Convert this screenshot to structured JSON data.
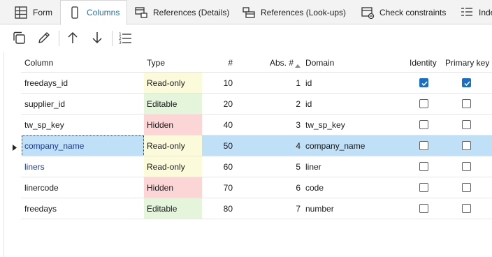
{
  "tabs": [
    {
      "label": "Form",
      "icon": "grid-form-icon",
      "active": false
    },
    {
      "label": "Columns",
      "icon": "column-icon",
      "active": true
    },
    {
      "label": "References (Details)",
      "icon": "references-details-icon",
      "active": false
    },
    {
      "label": "References (Look-ups)",
      "icon": "references-lookups-icon",
      "active": false
    },
    {
      "label": "Check constraints",
      "icon": "check-constraint-icon",
      "active": false
    },
    {
      "label": "Inde",
      "icon": "indexes-icon",
      "active": false
    }
  ],
  "toolbar": {
    "buttons": [
      "copy-icon",
      "edit-icon",
      "move-up-icon",
      "move-down-icon",
      "list-icon"
    ]
  },
  "grid": {
    "headers": {
      "column": "Column",
      "type": "Type",
      "num": "#",
      "abs": "Abs. #",
      "domain": "Domain",
      "identity": "Identity",
      "primary_key": "Primary key"
    },
    "rows": [
      {
        "column": "freedays_id",
        "type": "Read-only",
        "num": "10",
        "abs": "1",
        "domain": "id",
        "identity": true,
        "primary_key": true
      },
      {
        "column": "supplier_id",
        "type": "Editable",
        "num": "20",
        "abs": "2",
        "domain": "id",
        "identity": false,
        "primary_key": false
      },
      {
        "column": "tw_sp_key",
        "type": "Hidden",
        "num": "40",
        "abs": "3",
        "domain": "tw_sp_key",
        "identity": false,
        "primary_key": false
      },
      {
        "column": "company_name",
        "type": "Read-only",
        "num": "50",
        "abs": "4",
        "domain": "company_name",
        "identity": false,
        "primary_key": false
      },
      {
        "column": "liners",
        "type": "Read-only",
        "num": "60",
        "abs": "5",
        "domain": "liner",
        "identity": false,
        "primary_key": false
      },
      {
        "column": "linercode",
        "type": "Hidden",
        "num": "70",
        "abs": "6",
        "domain": "code",
        "identity": false,
        "primary_key": false
      },
      {
        "column": "freedays",
        "type": "Editable",
        "num": "80",
        "abs": "7",
        "domain": "number",
        "identity": false,
        "primary_key": false
      }
    ]
  },
  "colors": {
    "readonly_bg": "#fbfbdc",
    "editable_bg": "#e4f5dc",
    "hidden_bg": "#fcd6d6",
    "selected_bg": "#bfe0f7",
    "accent": "#1a6fc4",
    "blue_text": "#1d3aa0"
  }
}
